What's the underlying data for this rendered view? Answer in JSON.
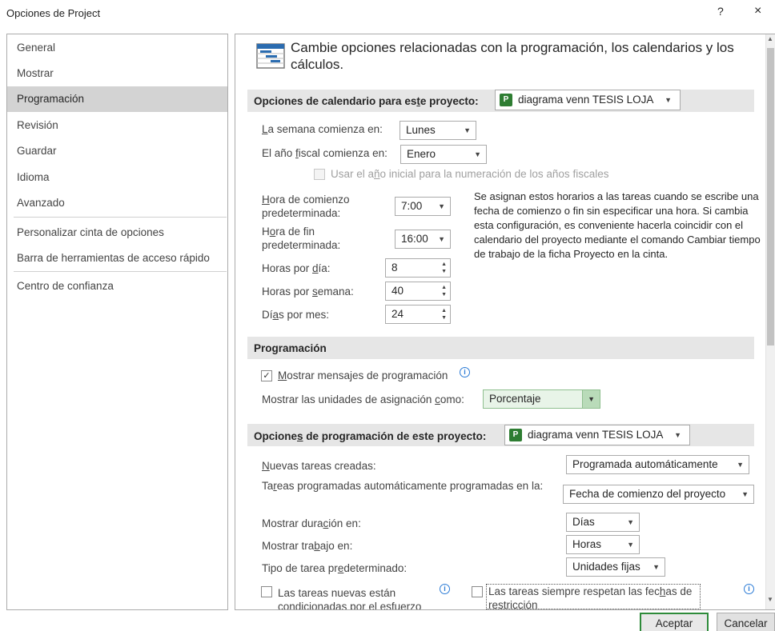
{
  "window": {
    "title": "Opciones de Project",
    "help": "?",
    "close": "×"
  },
  "nav": {
    "items": [
      {
        "label": "General"
      },
      {
        "label": "Mostrar"
      },
      {
        "label": "Programación"
      },
      {
        "label": "Revisión"
      },
      {
        "label": "Guardar"
      },
      {
        "label": "Idioma"
      },
      {
        "label": "Avanzado"
      },
      {
        "label": "Personalizar cinta de opciones"
      },
      {
        "label": "Barra de herramientas de acceso rápido"
      },
      {
        "label": "Centro de confianza"
      }
    ],
    "selected": "Programación"
  },
  "header": {
    "text": "Cambie opciones relacionadas con la programación, los calendarios y los cálculos."
  },
  "calendar": {
    "title_pre": "Opciones de calendario para es",
    "title_u": "t",
    "title_post": "e proyecto:",
    "project": "diagrama venn TESIS LOJA",
    "week_u": "L",
    "week_label": "a semana comienza en:",
    "week_value": "Lunes",
    "fiscal_pre": "El año ",
    "fiscal_u": "f",
    "fiscal_post": "iscal comienza en:",
    "fiscal_value": "Enero",
    "fiscal_chk_pre": "Usar el a",
    "fiscal_chk_u": "ñ",
    "fiscal_chk_post": "o inicial para la numeración de los años fiscales",
    "start_u": "H",
    "start_label": "ora de comienzo predeterminada:",
    "start_value": "7:00",
    "end_pre": "H",
    "end_u": "o",
    "end_label": "ra de fin predeterminada:",
    "end_value": "16:00",
    "hday_pre": "Horas por ",
    "hday_u": "d",
    "hday_post": "ía:",
    "hday_value": "8",
    "hweek_pre": "Horas por ",
    "hweek_u": "s",
    "hweek_post": "emana:",
    "hweek_value": "40",
    "dmonth_pre": "Dí",
    "dmonth_u": "a",
    "dmonth_post": "s por mes:",
    "dmonth_value": "24",
    "description": "Se asignan estos horarios a las tareas cuando se escribe una fecha de comienzo o fin sin especificar una hora. Si cambia esta configuración, es conveniente hacerla coincidir con el calendario del proyecto mediante el comando Cambiar tiempo de trabajo de la ficha Proyecto en la cinta."
  },
  "scheduling": {
    "title": "Programación",
    "show_msgs_u": "M",
    "show_msgs": "ostrar mensajes de programación",
    "show_msgs_checked": "✓",
    "units_pre": "Mostrar las unidades de asignación ",
    "units_u": "c",
    "units_post": "omo:",
    "units_value": "Porcentaje"
  },
  "project_sched": {
    "title_pre": "Opcione",
    "title_u": "s",
    "title_post": " de programación de este proyecto:",
    "project": "diagrama venn TESIS LOJA",
    "new_tasks_u": "N",
    "new_tasks": "uevas tareas creadas:",
    "new_tasks_value": "Programada automáticamente",
    "auto_pre": "Ta",
    "auto_u": "r",
    "auto_post": "eas programadas automáticamente programadas en la:",
    "auto_value": "Fecha de comienzo del proyecto",
    "dur_pre": "Mostrar dura",
    "dur_u": "c",
    "dur_post": "ión en:",
    "dur_value": "Días",
    "work_pre": "Mostrar tra",
    "work_u": "b",
    "work_post": "ajo en:",
    "work_value": "Horas",
    "type_pre": "Tipo de tarea pr",
    "type_u": "e",
    "type_post": "determinado:",
    "type_value": "Unidades fijas",
    "effort_label": "Las tareas nuevas están condicionadas por el esfuerzo",
    "respect_pre": "Las tareas siempre respetan las fec",
    "respect_u": "h",
    "respect_post": "as de restricción"
  },
  "buttons": {
    "ok": "Aceptar",
    "cancel": "Cancelar"
  }
}
